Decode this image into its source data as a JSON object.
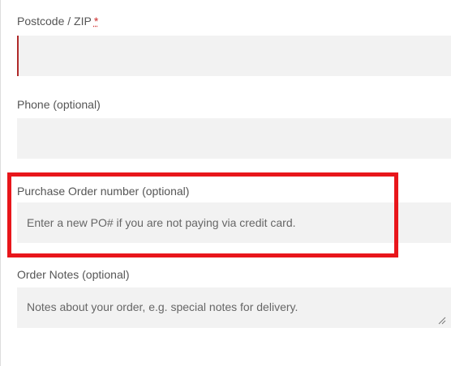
{
  "form": {
    "postcode": {
      "label": "Postcode / ZIP",
      "required_mark": "*",
      "value": ""
    },
    "phone": {
      "label": "Phone (optional)",
      "value": ""
    },
    "purchase_order": {
      "label": "Purchase Order number (optional)",
      "placeholder": "Enter a new PO# if you are not paying via credit card."
    },
    "order_notes": {
      "label": "Order Notes (optional)",
      "placeholder": "Notes about your order, e.g. special notes for delivery."
    }
  },
  "colors": {
    "field_background": "#f2f2f2",
    "required_star": "#cc2b2b",
    "invalid_border": "#b02a2a",
    "highlight": "#e8161b"
  }
}
